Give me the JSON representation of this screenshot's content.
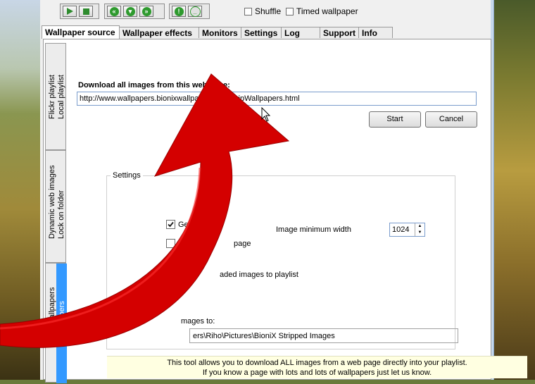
{
  "toolbar": {
    "shuffle_label": "Shuffle",
    "timed_label": "Timed wallpaper"
  },
  "tabs": [
    {
      "label": "Wallpaper source",
      "active": true
    },
    {
      "label": "Wallpaper effects",
      "active": false
    },
    {
      "label": "Monitors",
      "active": false
    },
    {
      "label": "Settings",
      "active": false
    },
    {
      "label": "Log",
      "active": false
    },
    {
      "label": "Support",
      "active": false
    },
    {
      "label": "Info",
      "active": false
    }
  ],
  "side_tabs": [
    {
      "label": "Flickr playlist"
    },
    {
      "label": "Local playlist"
    },
    {
      "label": "Dynamic web images"
    },
    {
      "label": "Lock on folder"
    },
    {
      "label": "Night wallpapers"
    },
    {
      "label": "p wallpapers"
    }
  ],
  "download": {
    "label": "Download all images from this web page:",
    "url": "http://www.wallpapers.bionixwallpaper.com/StripWallpapers.html",
    "start_label": "Start",
    "cancel_label": "Cancel"
  },
  "settings": {
    "legend": "Settings",
    "option1_partial": "Ge",
    "option1_checked": true,
    "option2_partial": "page",
    "option2_checked": false,
    "min_width_label": "Image minimum width",
    "min_width_value": "1024",
    "add_partial": "aded images to playlist",
    "save_partial": "mages to:",
    "save_path": "ers\\Riho\\Pictures\\BioniX Stripped Images"
  },
  "info": {
    "line1": "This tool allows you to download ALL images from a web page directly into your playlist.",
    "line2": "If you know a page with lots and lots of wallpapers just let us know."
  },
  "colors": {
    "arrow": "#d40000",
    "accent_green": "#2e8b2e",
    "info_bg": "#ffffe1"
  }
}
